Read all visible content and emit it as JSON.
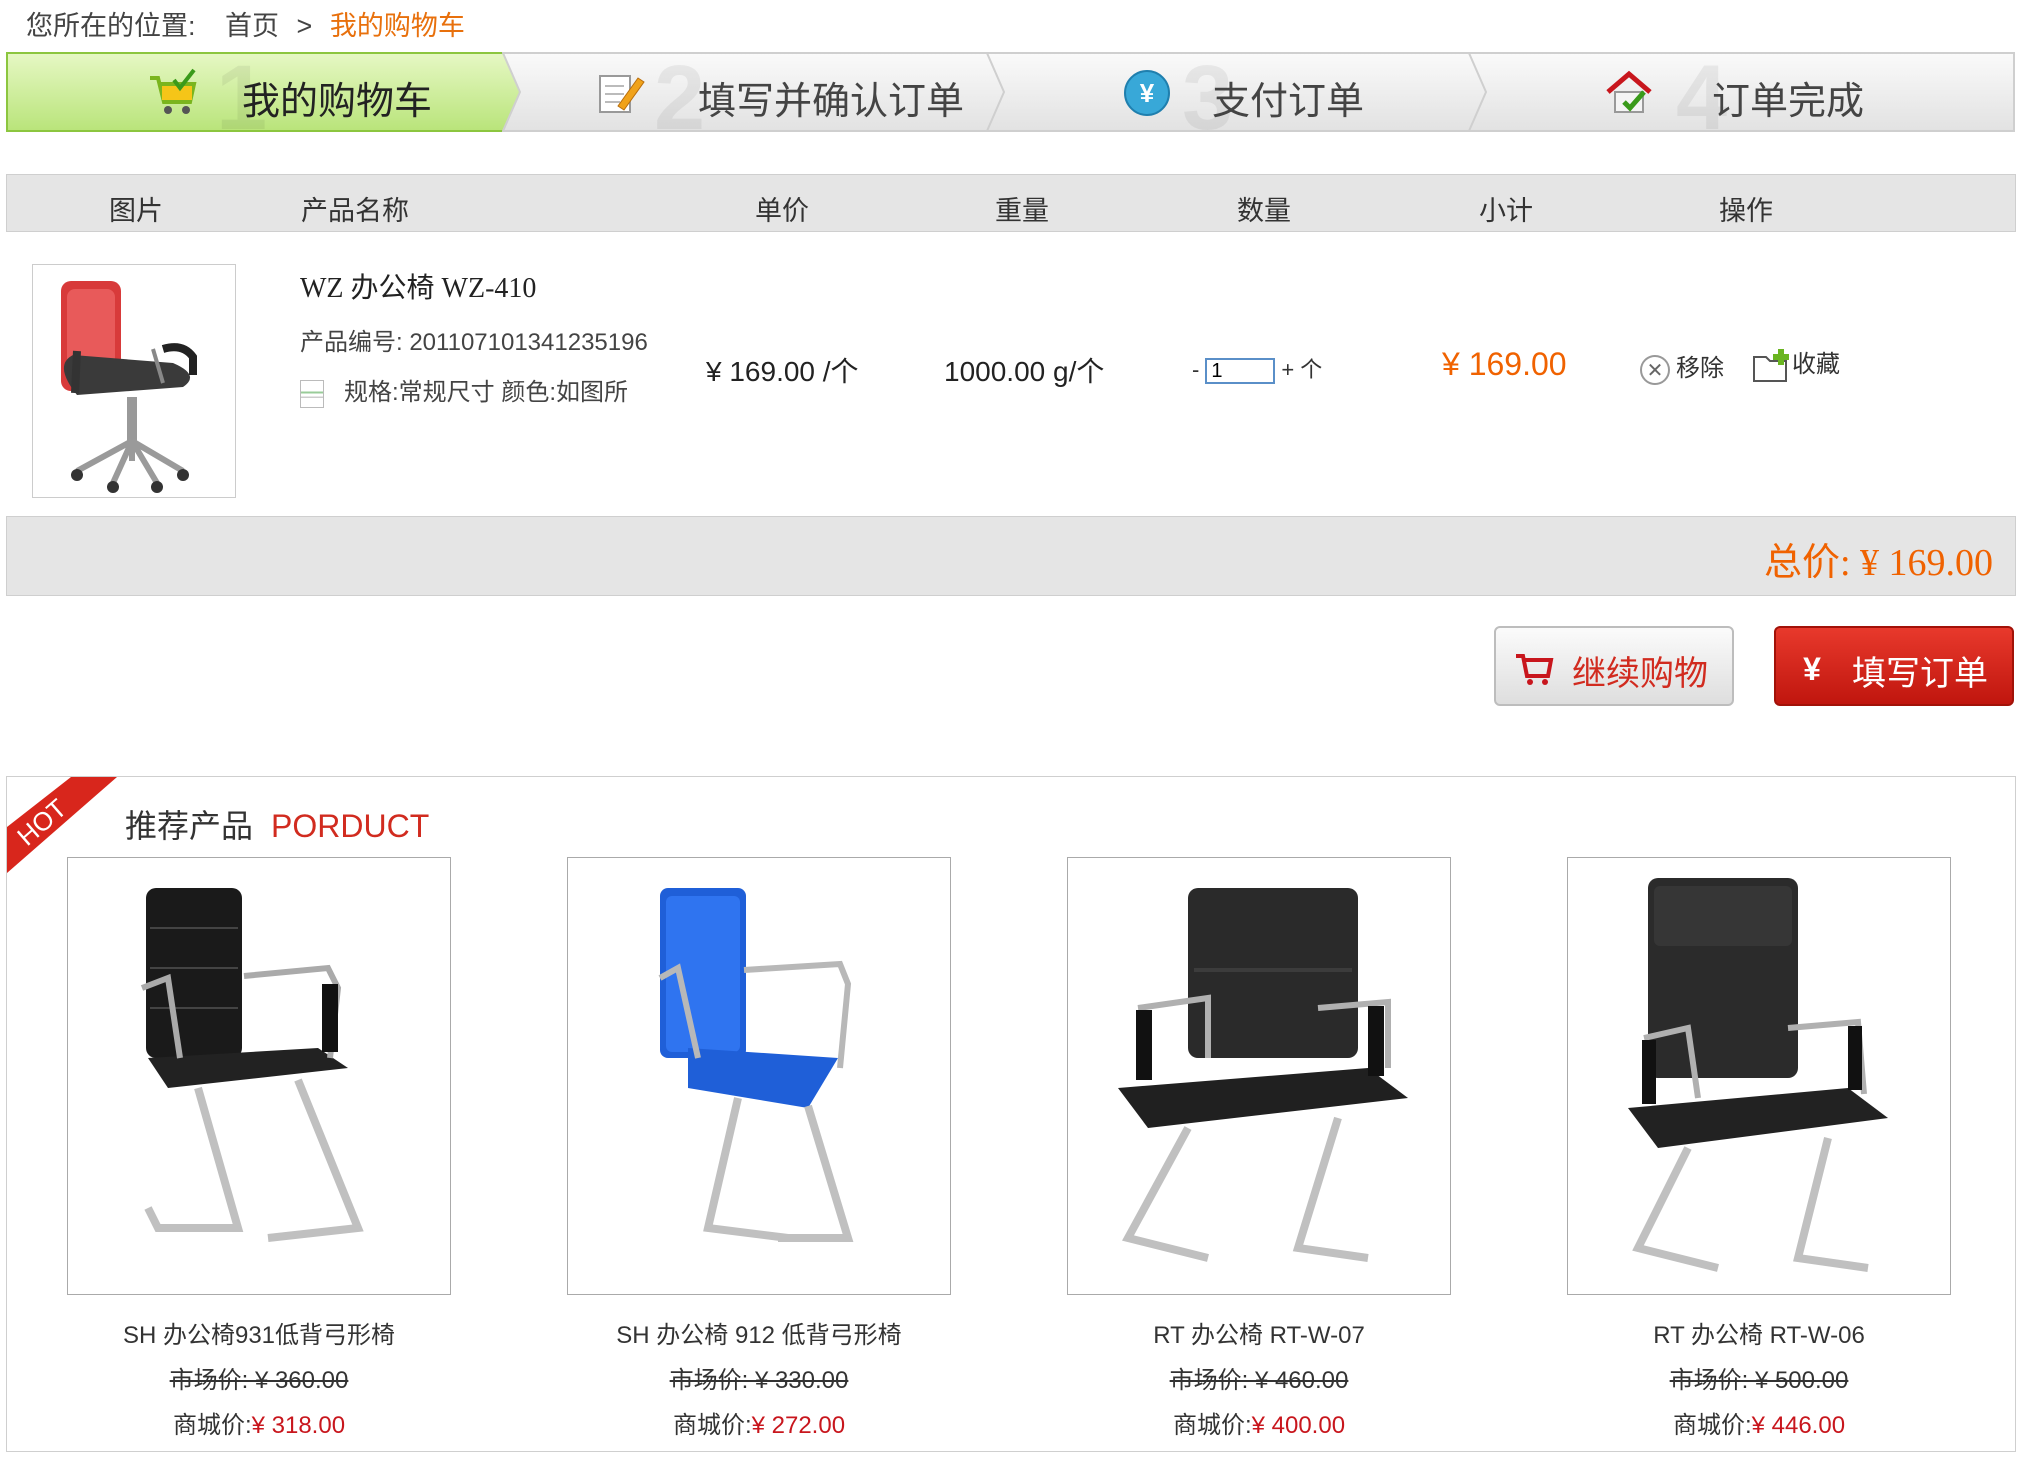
{
  "breadcrumb": {
    "prefix": "您所在的位置:",
    "home": "首页",
    "separator": ">",
    "current": "我的购物车"
  },
  "steps": [
    {
      "num": "1",
      "label": "我的购物车",
      "icon": "cart-icon"
    },
    {
      "num": "2",
      "label": "填写并确认订单",
      "icon": "edit-icon"
    },
    {
      "num": "3",
      "label": "支付订单",
      "icon": "yen-coin-icon"
    },
    {
      "num": "4",
      "label": "订单完成",
      "icon": "house-check-icon"
    }
  ],
  "table_headers": [
    "图片",
    "产品名称",
    "单价",
    "重量",
    "数量",
    "小计",
    "操作"
  ],
  "item": {
    "name": "WZ 办公椅 WZ-410",
    "code": "产品编号: 201107101341235196",
    "spec": "规格:常规尺寸  颜色:如图所",
    "unit_price": "¥ 169.00 /个",
    "weight": "1000.00 g/个",
    "qty_minus": "-",
    "qty_value": "1",
    "qty_plus": "+ 个",
    "subtotal": "¥ 169.00",
    "remove_label": "移除",
    "favorite_label": "收藏"
  },
  "total": "总价: ¥ 169.00",
  "buttons": {
    "continue": "继续购物",
    "order": "填写订单"
  },
  "recommend": {
    "badge": "HOT",
    "title": "推荐产品",
    "title_en": "PORDUCT",
    "products": [
      {
        "name": "SH 办公椅931低背弓形椅",
        "market": "市场价: ¥ 360.00",
        "mall_label": "商城价:",
        "mall_price": "¥ 318.00"
      },
      {
        "name": "SH 办公椅 912 低背弓形椅",
        "market": "市场价: ¥ 330.00",
        "mall_label": "商城价:",
        "mall_price": "¥ 272.00"
      },
      {
        "name": "RT 办公椅 RT-W-07",
        "market": "市场价: ¥ 460.00",
        "mall_label": "商城价:",
        "mall_price": "¥ 400.00"
      },
      {
        "name": "RT 办公椅 RT-W-06",
        "market": "市场价: ¥ 500.00",
        "mall_label": "商城价:",
        "mall_price": "¥ 446.00"
      }
    ]
  },
  "colors": {
    "accent_orange": "#f06200",
    "accent_red": "#c8161d",
    "active_step": "#c6ec88"
  }
}
